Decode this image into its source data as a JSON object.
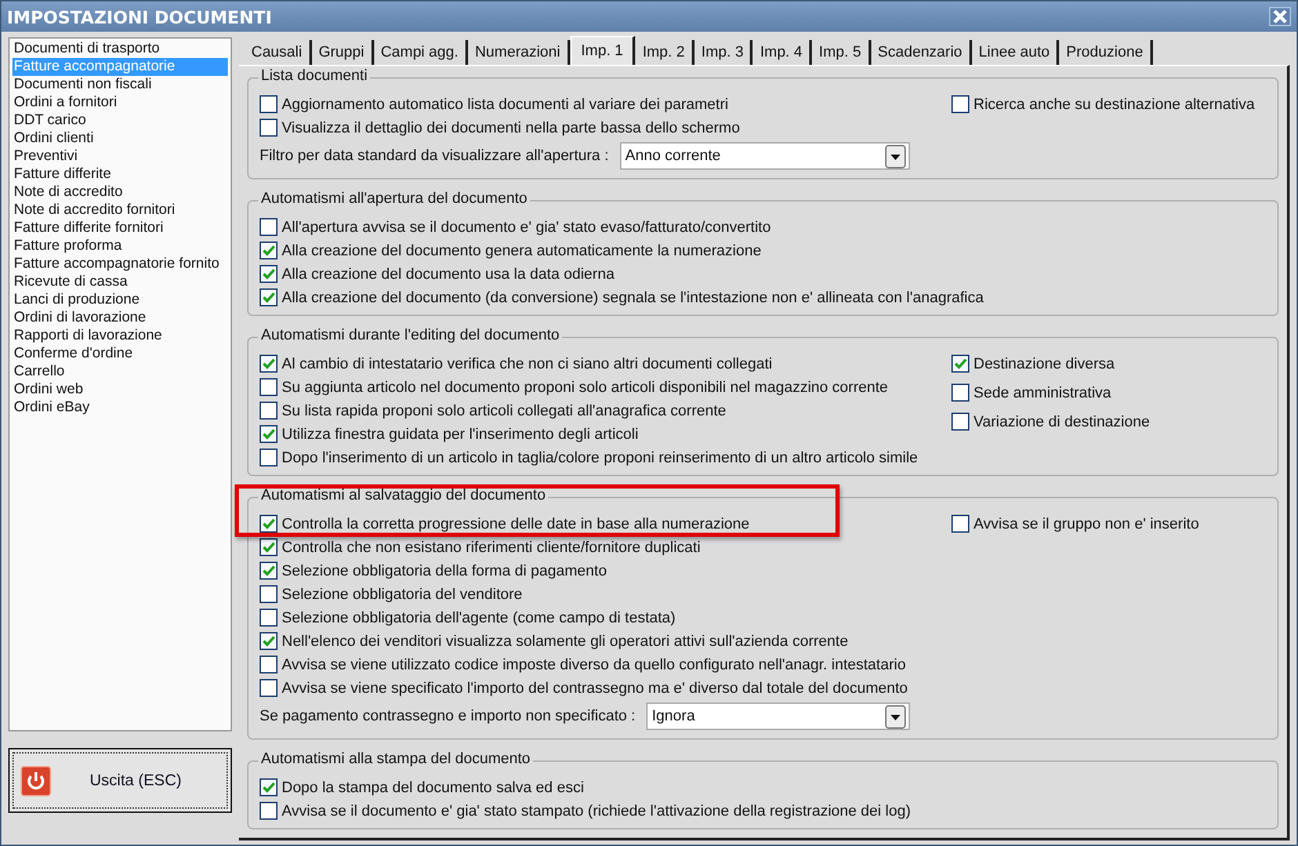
{
  "window": {
    "title": "IMPOSTAZIONI DOCUMENTI"
  },
  "document_types": [
    {
      "label": "Documenti di trasporto",
      "selected": false
    },
    {
      "label": "Fatture accompagnatorie",
      "selected": true
    },
    {
      "label": "Documenti non fiscali",
      "selected": false
    },
    {
      "label": "Ordini a fornitori",
      "selected": false
    },
    {
      "label": "DDT carico",
      "selected": false
    },
    {
      "label": "Ordini clienti",
      "selected": false
    },
    {
      "label": "Preventivi",
      "selected": false
    },
    {
      "label": "Fatture differite",
      "selected": false
    },
    {
      "label": "Note di accredito",
      "selected": false
    },
    {
      "label": "Note di accredito fornitori",
      "selected": false
    },
    {
      "label": "Fatture differite fornitori",
      "selected": false
    },
    {
      "label": "Fatture proforma",
      "selected": false
    },
    {
      "label": "Fatture accompagnatorie fornito",
      "selected": false
    },
    {
      "label": "Ricevute di cassa",
      "selected": false
    },
    {
      "label": "Lanci di produzione",
      "selected": false
    },
    {
      "label": "Ordini di lavorazione",
      "selected": false
    },
    {
      "label": "Rapporti di lavorazione",
      "selected": false
    },
    {
      "label": "Conferme d'ordine",
      "selected": false
    },
    {
      "label": "Carrello",
      "selected": false
    },
    {
      "label": "Ordini web",
      "selected": false
    },
    {
      "label": "Ordini eBay",
      "selected": false
    }
  ],
  "exit_button": {
    "label": "Uscita (ESC)"
  },
  "tabs": [
    {
      "label": "Causali",
      "selected": false
    },
    {
      "label": "Gruppi",
      "selected": false
    },
    {
      "label": "Campi agg.",
      "selected": false
    },
    {
      "label": "Numerazioni",
      "selected": false
    },
    {
      "label": "Imp. 1",
      "selected": true
    },
    {
      "label": "Imp. 2",
      "selected": false
    },
    {
      "label": "Imp. 3",
      "selected": false
    },
    {
      "label": "Imp. 4",
      "selected": false
    },
    {
      "label": "Imp. 5",
      "selected": false
    },
    {
      "label": "Scadenzario",
      "selected": false
    },
    {
      "label": "Linee auto",
      "selected": false
    },
    {
      "label": "Produzione",
      "selected": false
    }
  ],
  "groups": [
    {
      "title": "Lista documenti",
      "highlighted": false,
      "items": [
        {
          "kind": "checkbox",
          "label": "Aggiornamento automatico lista documenti al variare dei parametri",
          "checked": false
        },
        {
          "kind": "checkbox",
          "label": "Visualizza il dettaglio dei documenti nella parte bassa dello schermo",
          "checked": false
        },
        {
          "kind": "select",
          "label": "Filtro per data standard da visualizzare all'apertura :",
          "value": "Anno corrente"
        }
      ],
      "right_items": [
        {
          "kind": "checkbox",
          "label": "Ricerca anche su destinazione alternativa",
          "checked": false
        }
      ]
    },
    {
      "title": "Automatismi all'apertura del documento",
      "highlighted": false,
      "items": [
        {
          "kind": "checkbox",
          "label": "All'apertura avvisa se il documento e' gia' stato evaso/fatturato/convertito",
          "checked": false
        },
        {
          "kind": "checkbox",
          "label": "Alla creazione del documento genera automaticamente la numerazione",
          "checked": true
        },
        {
          "kind": "checkbox",
          "label": "Alla creazione del documento usa la data odierna",
          "checked": true
        },
        {
          "kind": "checkbox",
          "label": "Alla creazione del documento (da conversione) segnala se l'intestazione non e' allineata con l'anagrafica",
          "checked": true
        }
      ]
    },
    {
      "title": "Automatismi durante l'editing del documento",
      "highlighted": false,
      "items": [
        {
          "kind": "checkbox",
          "label": "Al cambio di intestatario verifica che non ci siano altri documenti collegati",
          "checked": true
        },
        {
          "kind": "checkbox",
          "label": "Su aggiunta articolo nel documento proponi solo articoli disponibili nel magazzino corrente",
          "checked": false
        },
        {
          "kind": "checkbox",
          "label": "Su lista rapida proponi solo articoli collegati all'anagrafica corrente",
          "checked": false
        },
        {
          "kind": "checkbox",
          "label": "Utilizza finestra guidata per l'inserimento degli articoli",
          "checked": true
        },
        {
          "kind": "checkbox",
          "label": "Dopo l'inserimento di un articolo in taglia/colore proponi reinserimento di un altro articolo simile",
          "checked": false
        }
      ],
      "right_items": [
        {
          "kind": "checkbox",
          "label": "Destinazione diversa",
          "checked": true
        },
        {
          "kind": "checkbox",
          "label": "Sede amministrativa",
          "checked": false
        },
        {
          "kind": "checkbox",
          "label": "Variazione di destinazione",
          "checked": false
        }
      ]
    },
    {
      "title": "Automatismi al salvataggio del documento",
      "highlighted": true,
      "items": [
        {
          "kind": "checkbox",
          "label": "Controlla la corretta progressione delle date in base alla numerazione",
          "checked": true
        },
        {
          "kind": "checkbox",
          "label": "Controlla che non esistano riferimenti cliente/fornitore duplicati",
          "checked": true
        },
        {
          "kind": "checkbox",
          "label": "Selezione obbligatoria della forma di pagamento",
          "checked": true
        },
        {
          "kind": "checkbox",
          "label": "Selezione obbligatoria del venditore",
          "checked": false
        },
        {
          "kind": "checkbox",
          "label": "Selezione obbligatoria dell'agente (come campo di testata)",
          "checked": false
        },
        {
          "kind": "checkbox",
          "label": "Nell'elenco dei venditori visualizza solamente gli operatori attivi sull'azienda corrente",
          "checked": true
        },
        {
          "kind": "checkbox",
          "label": "Avvisa se viene utilizzato codice imposte diverso da quello configurato nell'anagr. intestatario",
          "checked": false
        },
        {
          "kind": "checkbox",
          "label": "Avvisa se viene specificato l'importo del contrassegno ma e' diverso dal totale del documento",
          "checked": false
        },
        {
          "kind": "select",
          "label": "Se pagamento contrassegno e importo non specificato :",
          "value": "Ignora"
        }
      ],
      "right_items": [
        {
          "kind": "checkbox",
          "label": "Avvisa se il gruppo non e' inserito",
          "checked": false
        }
      ]
    },
    {
      "title": "Automatismi alla stampa del documento",
      "highlighted": false,
      "items": [
        {
          "kind": "checkbox",
          "label": "Dopo la stampa del documento salva ed esci",
          "checked": true
        },
        {
          "kind": "checkbox",
          "label": "Avvisa se il documento e' gia' stato stampato (richiede l'attivazione della registrazione dei log)",
          "checked": false
        }
      ]
    }
  ]
}
